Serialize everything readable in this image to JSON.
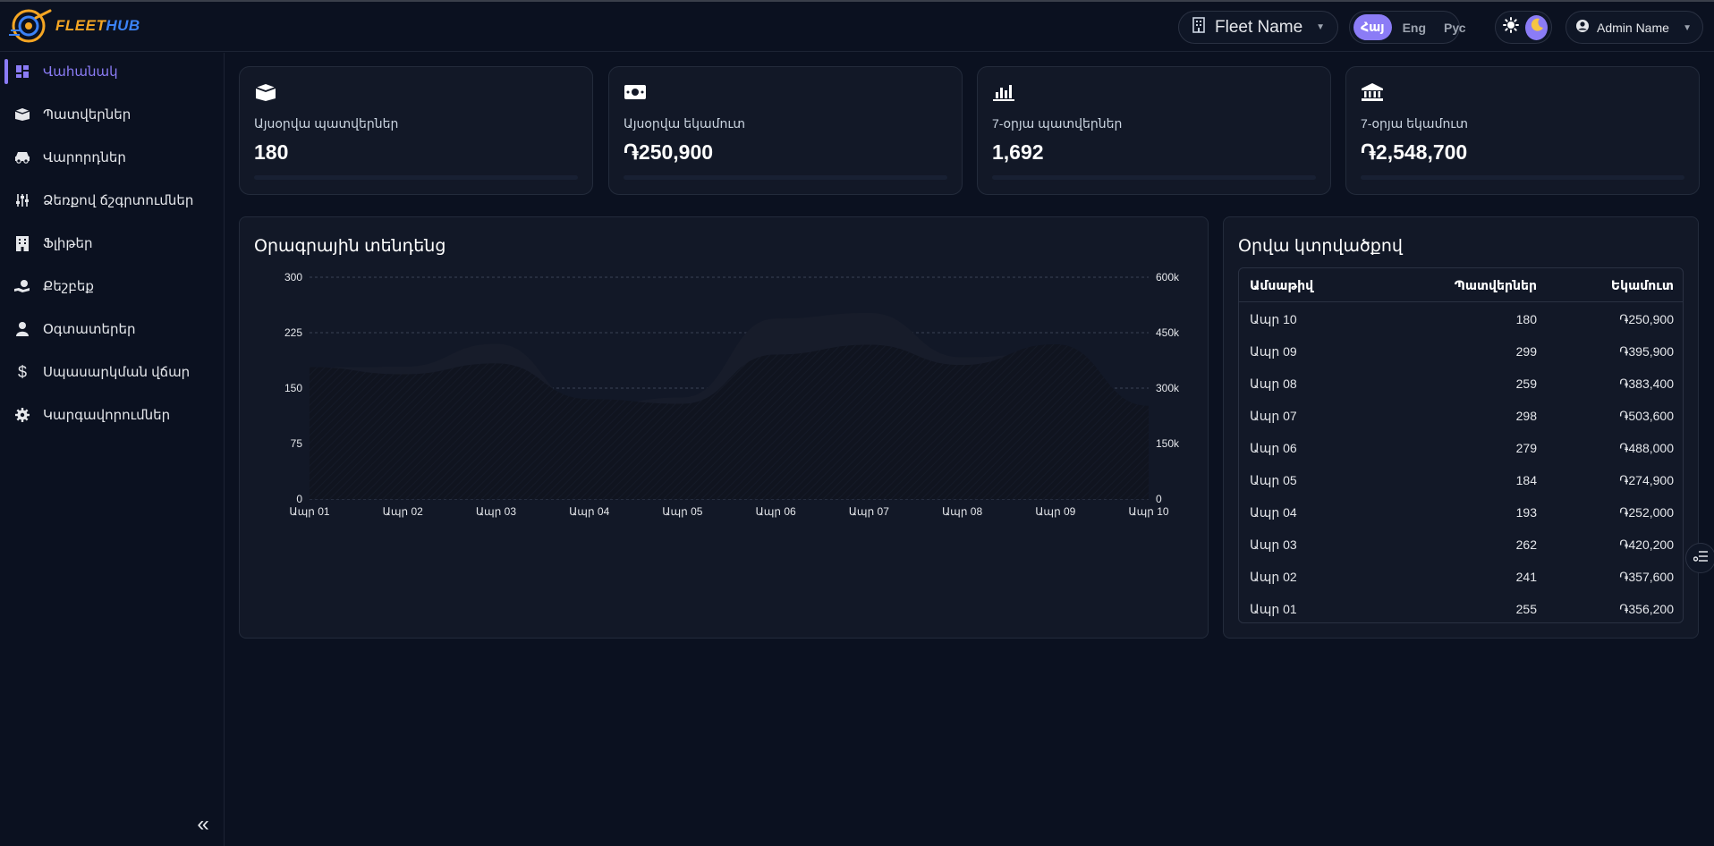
{
  "header": {
    "logo": {
      "word1": "FLEET",
      "word2": "HUB"
    },
    "fleet_select": {
      "label": "Fleet Name"
    },
    "languages": [
      {
        "label": "Հայ",
        "active": true
      },
      {
        "label": "Eng",
        "active": false
      },
      {
        "label": "Рус",
        "active": false
      }
    ],
    "theme": {
      "active": "dark"
    },
    "user": {
      "name": "Admin Name"
    }
  },
  "sidebar": {
    "items": [
      {
        "label": "Վահանակ",
        "icon": "dashboard-icon",
        "active": true
      },
      {
        "label": "Պատվերներ",
        "icon": "box-icon",
        "active": false
      },
      {
        "label": "Վարորդներ",
        "icon": "car-icon",
        "active": false
      },
      {
        "label": "Ձեռքով ճշգրտումներ",
        "icon": "sliders-icon",
        "active": false
      },
      {
        "label": "Ֆլիթեր",
        "icon": "building-icon",
        "active": false
      },
      {
        "label": "Քեշբեք",
        "icon": "cashback-icon",
        "active": false
      },
      {
        "label": "Օգտատերեր",
        "icon": "user-icon",
        "active": false
      },
      {
        "label": "Սպասարկման վճար",
        "icon": "dollar-icon",
        "active": false
      },
      {
        "label": "Կարգավորումներ",
        "icon": "gear-icon",
        "active": false
      }
    ]
  },
  "stats": [
    {
      "label": "Այսօրվա պատվերներ",
      "value": "180",
      "icon": "box-icon"
    },
    {
      "label": "Այսօրվա եկամուտ",
      "value": "֏250,900",
      "icon": "money-icon"
    },
    {
      "label": "7-օրյա պատվերներ",
      "value": "1,692",
      "icon": "bar-chart-icon"
    },
    {
      "label": "7-օրյա եկամուտ",
      "value": "֏2,548,700",
      "icon": "bank-icon"
    }
  ],
  "trend": {
    "title": "Օրագրային տենդենց"
  },
  "chart_data": {
    "type": "area",
    "title": "Օրագրային տենդենց",
    "categories": [
      "Ապր 01",
      "Ապր 02",
      "Ապր 03",
      "Ապր 04",
      "Ապր 05",
      "Ապր 06",
      "Ապր 07",
      "Ապր 08",
      "Ապր 09",
      "Ապր 10"
    ],
    "series": [
      {
        "axis": "left",
        "values": [
          255,
          241,
          262,
          193,
          184,
          279,
          298,
          259,
          299,
          180
        ]
      },
      {
        "axis": "right",
        "values": [
          356200,
          357600,
          420200,
          252000,
          274900,
          488000,
          503600,
          383400,
          395900,
          250900
        ]
      }
    ],
    "y_left": {
      "min": 0,
      "max": 300,
      "ticks": [
        "0",
        "75",
        "150",
        "225",
        "300"
      ]
    },
    "y_right": {
      "min": 0,
      "max": 600000,
      "ticks": [
        "0",
        "150k",
        "300k",
        "450k",
        "600k"
      ]
    },
    "grid": true
  },
  "daily": {
    "title": "Օրվա կտրվածքով",
    "columns": [
      "Ամսաթիվ",
      "Պատվերներ",
      "Եկամուտ"
    ],
    "rows": [
      [
        "Ապր 10",
        "180",
        "֏250,900"
      ],
      [
        "Ապր 09",
        "299",
        "֏395,900"
      ],
      [
        "Ապր 08",
        "259",
        "֏383,400"
      ],
      [
        "Ապր 07",
        "298",
        "֏503,600"
      ],
      [
        "Ապր 06",
        "279",
        "֏488,000"
      ],
      [
        "Ապր 05",
        "184",
        "֏274,900"
      ],
      [
        "Ապր 04",
        "193",
        "֏252,000"
      ],
      [
        "Ապր 03",
        "262",
        "֏420,200"
      ],
      [
        "Ապր 02",
        "241",
        "֏357,600"
      ],
      [
        "Ապր 01",
        "255",
        "֏356,200"
      ]
    ]
  },
  "colors": {
    "accent": "#8b7cf6",
    "background": "#0b1120",
    "card": "#121827",
    "logo_orange": "#f5a623",
    "logo_blue": "#3b82f6"
  }
}
